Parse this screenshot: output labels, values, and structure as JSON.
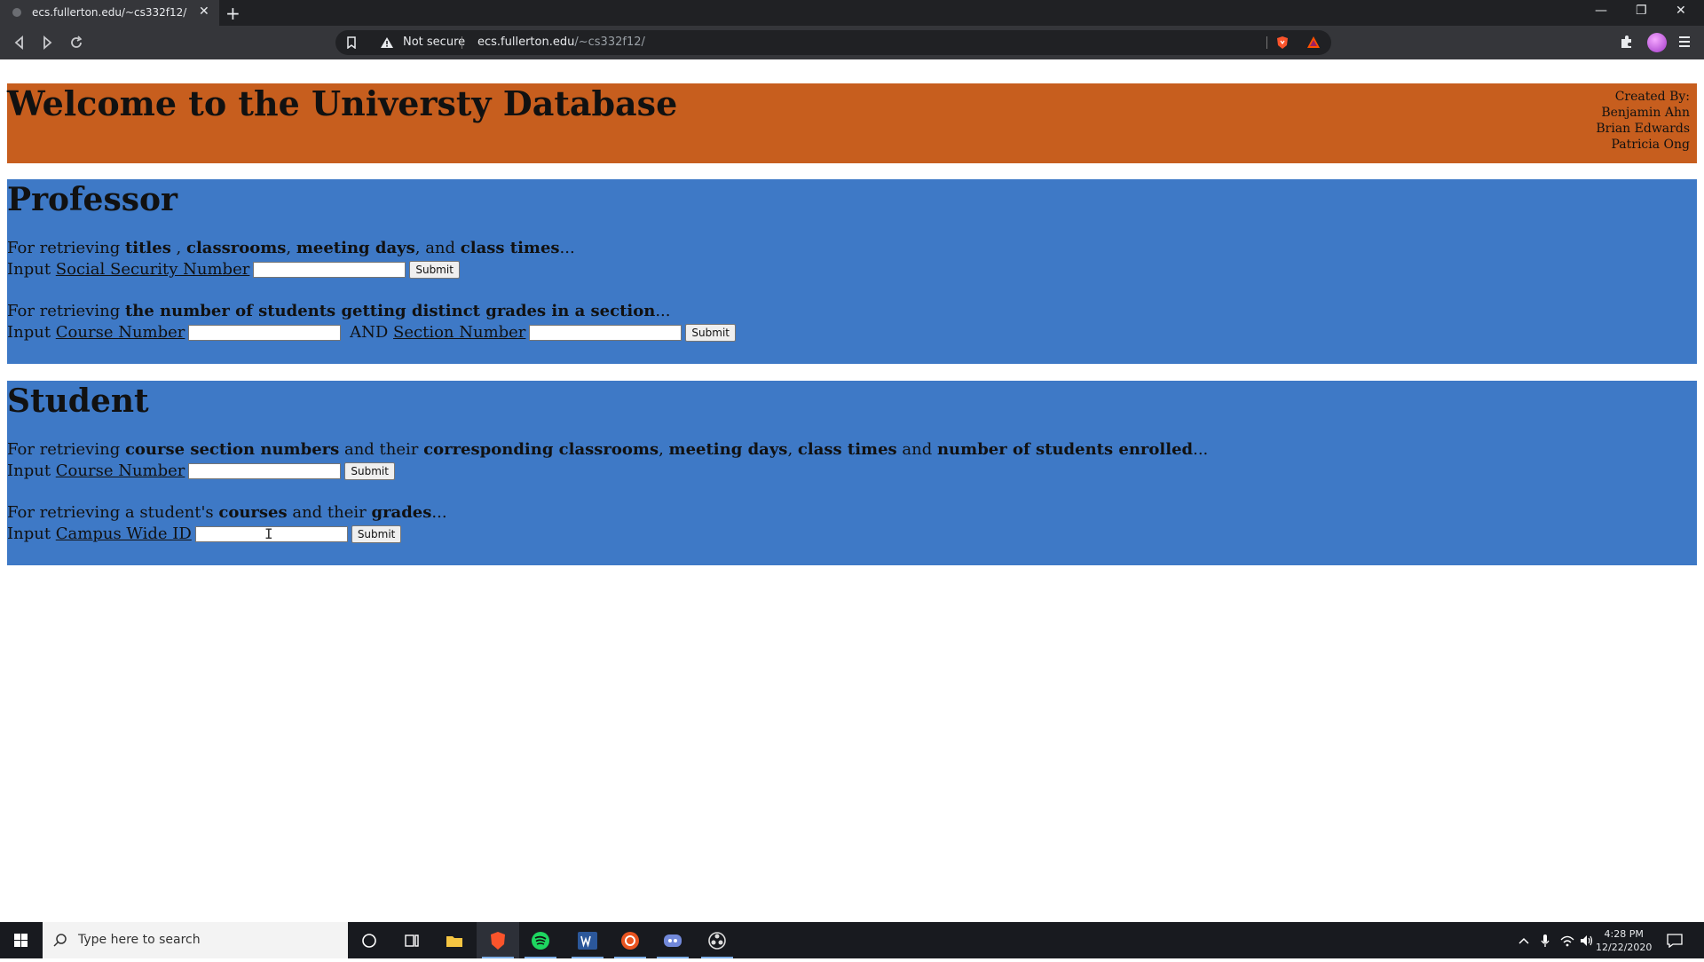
{
  "browser": {
    "tab_title": "ecs.fullerton.edu/~cs332f12/",
    "new_tab": "+",
    "security_label": "Not secure",
    "url_host": "ecs.fullerton.edu",
    "url_path": "/~cs332f12/"
  },
  "page": {
    "banner_title": "Welcome to the Universty Database",
    "credits": {
      "heading": "Created By:",
      "names": [
        "Benjamin Ahn",
        "Brian Edwards",
        "Patricia Ong"
      ]
    },
    "professor": {
      "heading": "Professor",
      "q1": {
        "pre": "For retrieving ",
        "b1": "titles",
        "t1": " , ",
        "b2": "classrooms",
        "t2": ", ",
        "b3": "meeting days",
        "t3": ", and ",
        "b4": "class times",
        "post": "...",
        "input_prefix": "Input ",
        "input_label": "Social Security Number",
        "submit": "Submit"
      },
      "q2": {
        "pre": "For retrieving ",
        "b1": "the number of students getting distinct grades in a section",
        "post": "...",
        "input_prefix": "Input ",
        "input_label1": "Course Number",
        "and_text": " AND ",
        "input_label2": "Section Number",
        "submit": "Submit"
      }
    },
    "student": {
      "heading": "Student",
      "q1": {
        "pre": "For retrieving ",
        "b1": "course section numbers",
        "t1": " and their ",
        "b2": "corresponding classrooms",
        "t2": ", ",
        "b3": "meeting days",
        "t3": ", ",
        "b4": "class times",
        "t4": " and ",
        "b5": "number of students enrolled",
        "post": "...",
        "input_prefix": "Input ",
        "input_label": "Course Number",
        "submit": "Submit"
      },
      "q2": {
        "pre": "For retrieving a student's ",
        "b1": "courses",
        "t1": " and their ",
        "b2": "grades",
        "post": "...",
        "input_prefix": "Input ",
        "input_label": "Campus Wide ID",
        "submit": "Submit"
      }
    }
  },
  "taskbar": {
    "search_placeholder": "Type here to search",
    "time": "4:28 PM",
    "date": "12/22/2020"
  },
  "colors": {
    "banner": "#c75e1e",
    "section": "#3e79c6"
  }
}
